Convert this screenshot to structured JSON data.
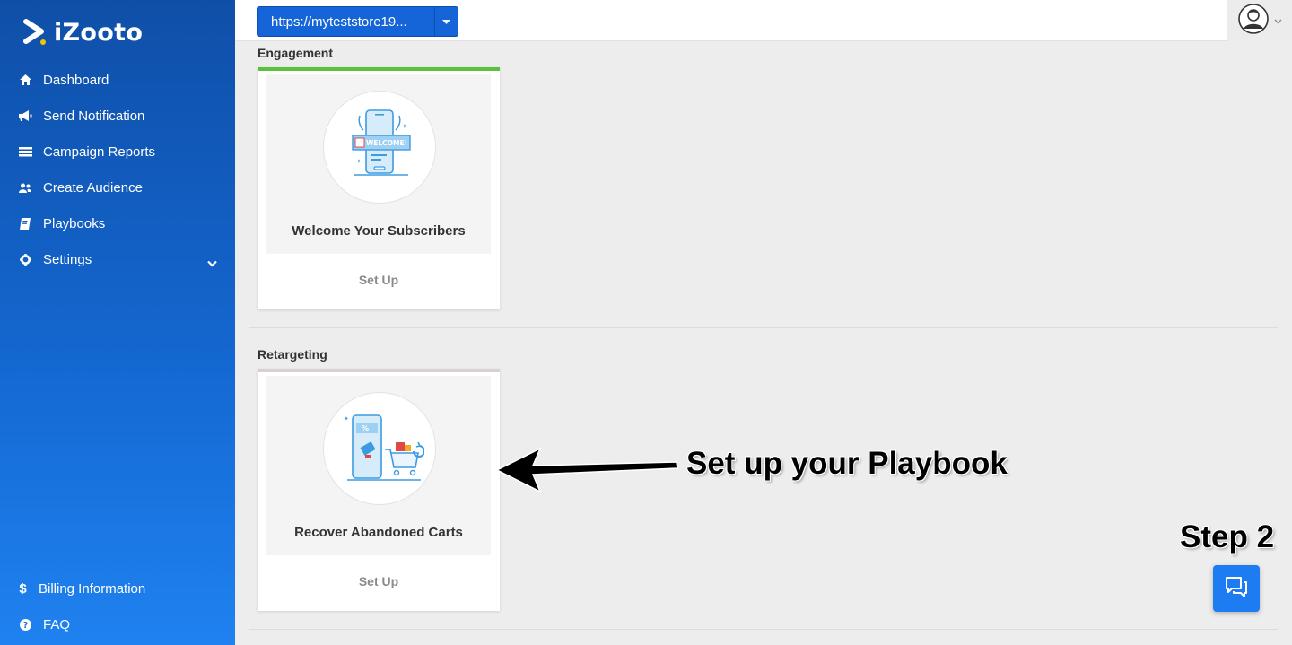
{
  "brand": {
    "name": "iZooto"
  },
  "sidebar": {
    "items": [
      {
        "label": "Dashboard",
        "icon": "home-icon"
      },
      {
        "label": "Send Notification",
        "icon": "megaphone-icon"
      },
      {
        "label": "Campaign Reports",
        "icon": "reports-icon"
      },
      {
        "label": "Create Audience",
        "icon": "users-icon"
      },
      {
        "label": "Playbooks",
        "icon": "book-icon"
      },
      {
        "label": "Settings",
        "icon": "gear-icon"
      }
    ],
    "bottom": [
      {
        "label": "Billing Information",
        "icon": "dollar-icon"
      },
      {
        "label": "FAQ",
        "icon": "question-icon"
      }
    ]
  },
  "topbar": {
    "site_url": "https://myteststore19...",
    "avatar_icon": "user-avatar-icon"
  },
  "sections": [
    {
      "title": "Engagement",
      "bar_color": "#58c23c",
      "card": {
        "title": "Welcome Your Subscribers",
        "action": "Set Up",
        "illustration_text": "WELCOME!"
      }
    },
    {
      "title": "Retargeting",
      "bar_color": "#d9d0d0",
      "card": {
        "title": "Recover Abandoned Carts",
        "action": "Set Up",
        "illustration_text": "%"
      }
    }
  ],
  "annotations": {
    "arrow_label": "Set up your Playbook",
    "step_label": "Step 2"
  },
  "colors": {
    "accent": "#1565d8",
    "sidebar_top": "#0f4fa8",
    "sidebar_bottom": "#1f82f0",
    "chat": "#1e7cf2"
  }
}
